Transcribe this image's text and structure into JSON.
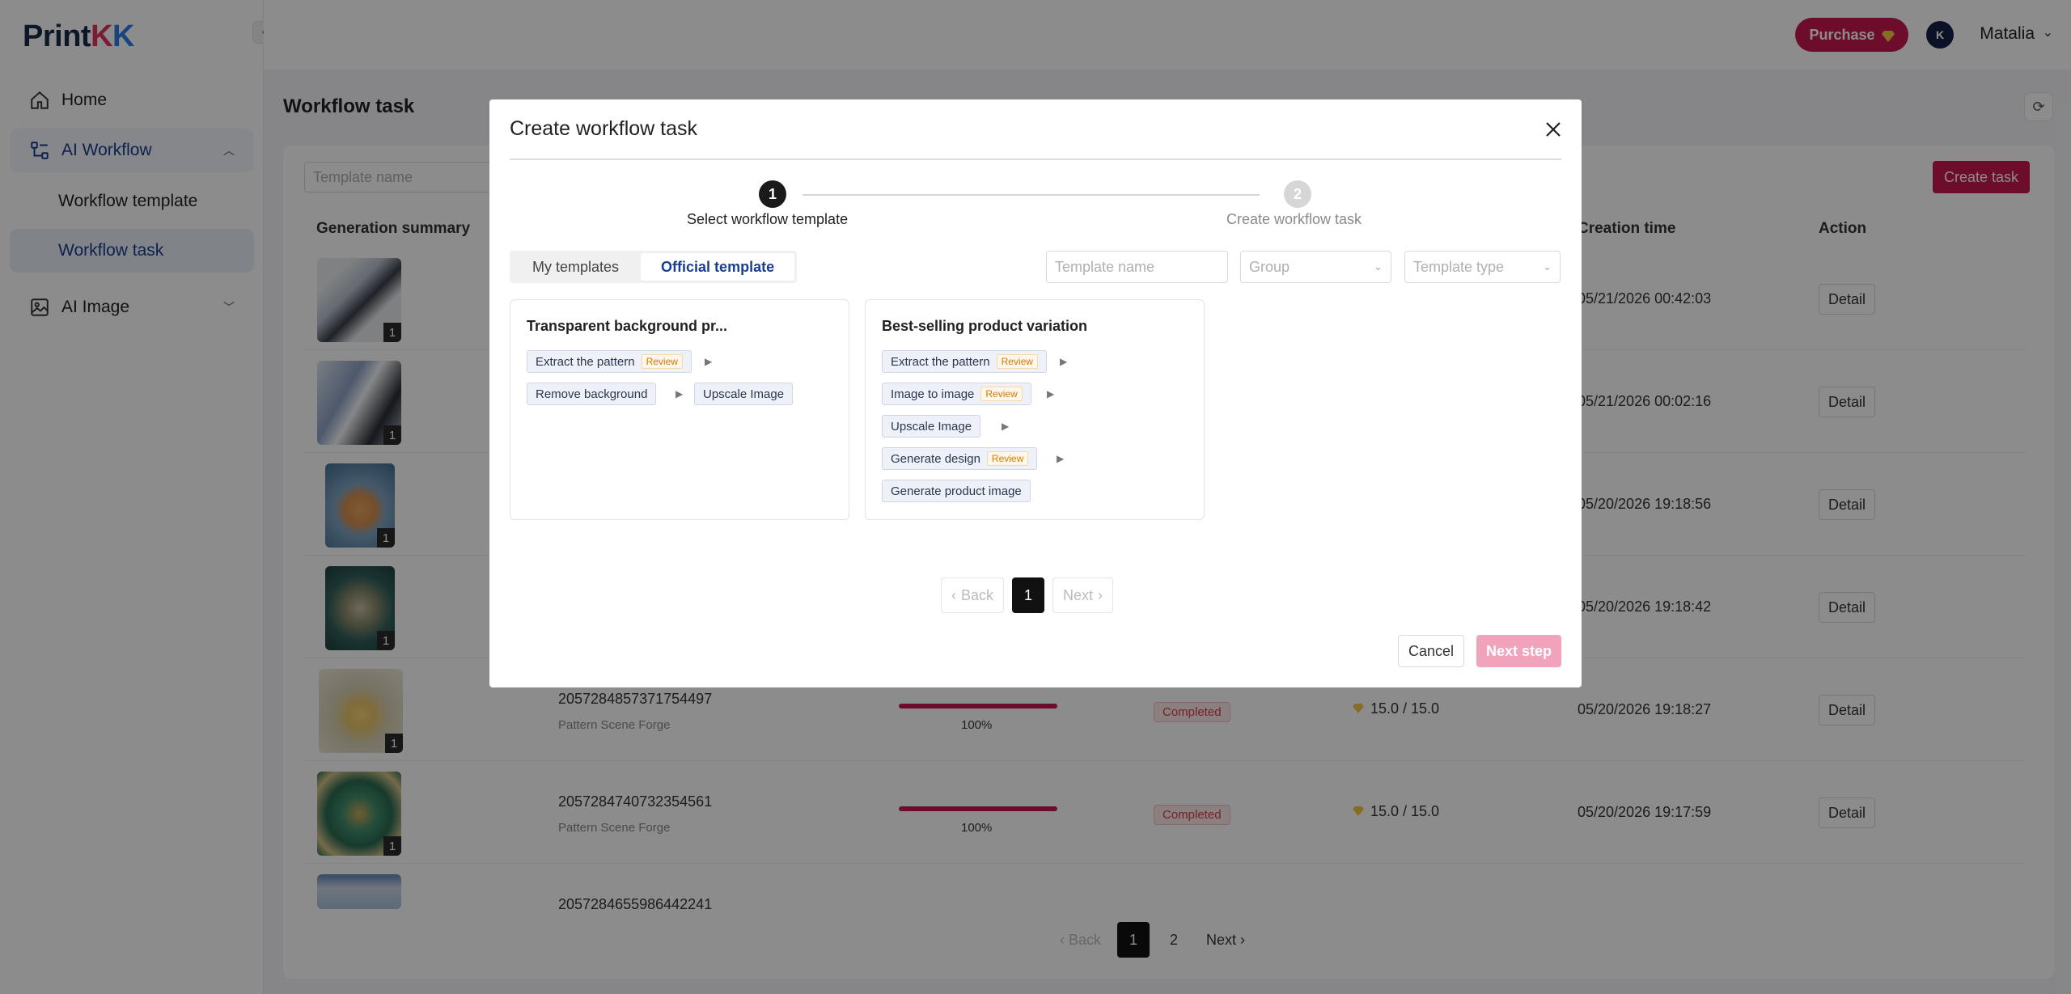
{
  "brand": {
    "name_a": "Print",
    "name_b": "K",
    "name_c": "K"
  },
  "sidebar": {
    "items": [
      {
        "label": "Home"
      },
      {
        "label": "AI Workflow"
      },
      {
        "label": "Workflow template"
      },
      {
        "label": "Workflow task"
      },
      {
        "label": "AI Image"
      }
    ]
  },
  "topbar": {
    "purchase_label": "Purchase",
    "avatar_initials": "K",
    "username": "Matalia"
  },
  "main": {
    "title": "Workflow task",
    "filter_placeholder": "Template name",
    "create_task_label": "Create task",
    "columns": {
      "summary": "Generation summary",
      "creation_time": "Creation time",
      "action": "Action"
    },
    "rows": [
      {
        "badge": "1",
        "id": "",
        "template": "",
        "progress": "",
        "status": "",
        "credits": "",
        "time": "05/21/2026 00:42:03",
        "action": "Detail"
      },
      {
        "badge": "1",
        "id": "",
        "template": "",
        "progress": "",
        "status": "",
        "credits": "",
        "time": "05/21/2026 00:02:16",
        "action": "Detail"
      },
      {
        "badge": "1",
        "id": "",
        "template": "",
        "progress": "",
        "status": "",
        "credits": "",
        "time": "05/20/2026 19:18:56",
        "action": "Detail"
      },
      {
        "badge": "1",
        "id": "",
        "template": "",
        "progress": "",
        "status": "",
        "credits": "",
        "time": "05/20/2026 19:18:42",
        "action": "Detail"
      },
      {
        "badge": "1",
        "id": "2057284857371754497",
        "template": "Pattern Scene Forge",
        "progress": "100%",
        "status": "Completed",
        "credits": "15.0 / 15.0",
        "time": "05/20/2026 19:18:27",
        "action": "Detail"
      },
      {
        "badge": "1",
        "id": "2057284740732354561",
        "template": "Pattern Scene Forge",
        "progress": "100%",
        "status": "Completed",
        "credits": "15.0 / 15.0",
        "time": "05/20/2026 19:17:59",
        "action": "Detail"
      },
      {
        "badge": "",
        "id": "2057284655986442241",
        "template": "",
        "progress": "",
        "status": "",
        "credits": "",
        "time": "",
        "action": ""
      }
    ],
    "pager": {
      "back": "Back",
      "pages": [
        "1",
        "2"
      ],
      "current": "1",
      "next": "Next"
    }
  },
  "modal": {
    "title": "Create workflow task",
    "steps": [
      {
        "number": "1",
        "label": "Select workflow template"
      },
      {
        "number": "2",
        "label": "Create workflow task"
      }
    ],
    "tabs": [
      {
        "label": "My templates"
      },
      {
        "label": "Official template"
      }
    ],
    "filters": {
      "template_name_placeholder": "Template name",
      "group_placeholder": "Group",
      "template_type_placeholder": "Template type"
    },
    "cards": [
      {
        "title": "Transparent background pr...",
        "chips": [
          {
            "label": "Extract the pattern",
            "review": "Review"
          },
          {
            "label": "Remove background",
            "review": ""
          },
          {
            "label": "Upscale Image",
            "review": ""
          }
        ]
      },
      {
        "title": "Best-selling product variation",
        "chips": [
          {
            "label": "Extract the pattern",
            "review": "Review"
          },
          {
            "label": "Image to image",
            "review": "Review"
          },
          {
            "label": "Upscale Image",
            "review": ""
          },
          {
            "label": "Generate design",
            "review": "Review"
          },
          {
            "label": "Generate product image",
            "review": ""
          }
        ]
      }
    ],
    "pager": {
      "back": "Back",
      "current": "1",
      "next": "Next"
    },
    "cancel_label": "Cancel",
    "next_step_label": "Next step"
  },
  "colors": {
    "accent": "#c8184f",
    "accent_disabled": "#f2a3bc",
    "nav_active": "#1a3d8f"
  }
}
